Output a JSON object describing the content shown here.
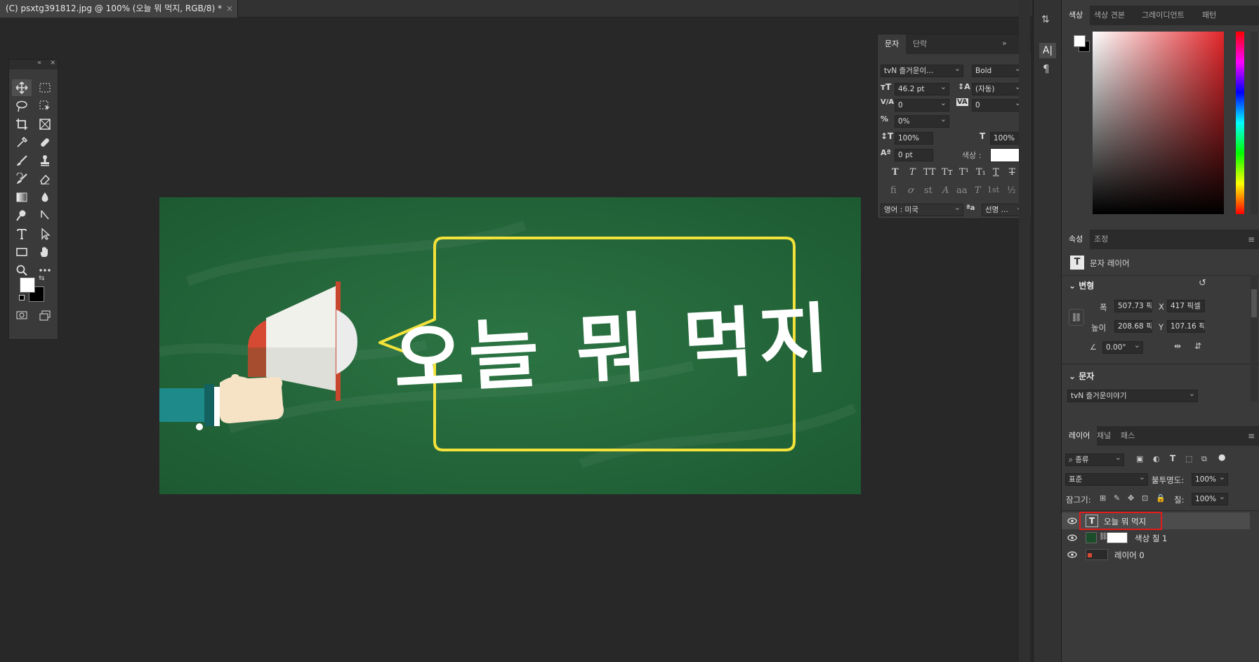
{
  "document": {
    "tab_title": "(C) psxtg391812.jpg @ 100% (오늘 뭐 먹지, RGB/8) *",
    "close": "×",
    "banner_text": "오늘 뭐 먹지"
  },
  "colors": {
    "canvas_green": "#24653a",
    "speech_yellow": "#f2e23a",
    "megaphone_red": "#d64a33",
    "highlight_red": "#e21b1b",
    "sleeve_teal": "#1f8a8a"
  },
  "character_panel": {
    "tabs": [
      "문자",
      "단락"
    ],
    "font_family": "tvN 즐거운이...",
    "font_style": "Bold",
    "font_size": "46.2 pt",
    "leading": "(자동)",
    "kerning": "0",
    "tracking": "0",
    "tsume": "0%",
    "vertical_scale": "100%",
    "horizontal_scale": "100%",
    "baseline_shift": "0 pt",
    "color_label": "색상 :",
    "language": "영어 : 미국",
    "antialias_icon_label": "ªa",
    "antialias": "선명 ...",
    "glyph_row1": [
      "T",
      "T",
      "TT",
      "Tт",
      "T¹",
      "T₁",
      "T",
      "T"
    ],
    "glyph_row2": [
      "fi",
      "ơ",
      "st",
      "A",
      "aa",
      "T",
      "1st",
      "½"
    ]
  },
  "color_panel": {
    "tabs": [
      "색상",
      "색상 견본",
      "그레이디언트",
      "패턴"
    ]
  },
  "properties_panel": {
    "tabs": [
      "속성",
      "조정"
    ],
    "layer_kind": "문자 레이어",
    "transform_header": "변형",
    "width_label": "폭",
    "width_value": "507.73 픽",
    "height_label": "높이",
    "height_value": "208.68 픽",
    "x_label": "X",
    "x_value": "417 픽셀",
    "y_label": "Y",
    "y_value": "107.16 픽",
    "angle_value": "0.00°",
    "text_header": "문자",
    "font_value": "tvN 즐거운이야기"
  },
  "layers_panel": {
    "tabs": [
      "레이어",
      "채널",
      "패스"
    ],
    "filter_kind": "종류",
    "blend_mode": "표준",
    "opacity_label": "불투명도:",
    "opacity_value": "100%",
    "lock_label": "잠그기:",
    "fill_label": "칠:",
    "fill_value": "100%",
    "layers": [
      {
        "name": "오늘 뭐 먹지",
        "type": "text",
        "selected": true
      },
      {
        "name": "색상 칠 1",
        "type": "fill",
        "selected": false
      },
      {
        "name": "레이어 0",
        "type": "image",
        "selected": false
      }
    ]
  }
}
